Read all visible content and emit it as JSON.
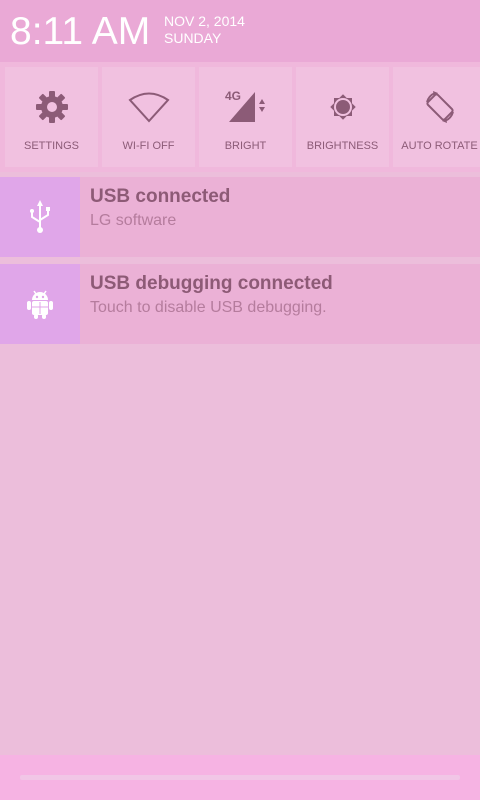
{
  "header": {
    "time": "8:11 AM",
    "date": "NOV 2, 2014",
    "day": "SUNDAY"
  },
  "quick_settings": [
    {
      "label": "SETTINGS",
      "icon": "gear-icon"
    },
    {
      "label": "WI-FI OFF",
      "icon": "wifi-icon"
    },
    {
      "label": "BRIGHT",
      "icon": "signal-4g-icon",
      "badge": "4G"
    },
    {
      "label": "BRIGHTNESS",
      "icon": "brightness-icon"
    },
    {
      "label": "AUTO ROTATE",
      "icon": "auto-rotate-icon"
    }
  ],
  "notifications": [
    {
      "title": "USB connected",
      "text": "LG software",
      "icon": "usb-icon"
    },
    {
      "title": "USB debugging connected",
      "text": "Touch to disable USB debugging.",
      "icon": "android-bug-icon"
    }
  ],
  "colors": {
    "header_bg": "#eaa9d6",
    "panel_bg": "#ecbedb",
    "tile_bg": "#f1c1e0",
    "notif_bg": "#ebb1d6",
    "notif_icon_bg": "#e0a6e9",
    "icon_color": "#8c5b77",
    "bottom_bar": "#f6b3e3"
  }
}
